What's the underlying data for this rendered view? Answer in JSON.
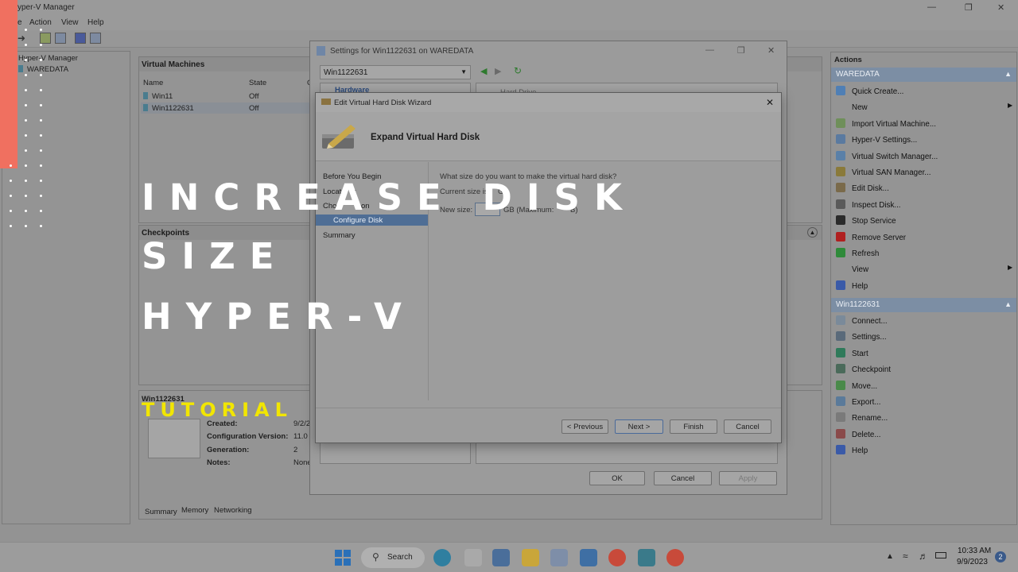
{
  "app": {
    "title": "Hyper-V Manager",
    "title_visible": "yper-V Manager",
    "menu": [
      "e",
      "Action",
      "View",
      "Help"
    ]
  },
  "tree": {
    "root": "Hyper-V Manager",
    "server": "WAREDATA"
  },
  "vms": {
    "header": "Virtual Machines",
    "columns": [
      "Name",
      "State",
      "C"
    ],
    "rows": [
      {
        "name": "Win11",
        "state": "Off"
      },
      {
        "name": "Win1122631",
        "state": "Off"
      }
    ]
  },
  "checkpoints": {
    "header": "Checkpoints"
  },
  "details": {
    "name": "Win1122631",
    "created_label": "Created:",
    "created_value": "9/2/2",
    "config_label": "Configuration Version:",
    "config_value": "11.0",
    "gen_label": "Generation:",
    "gen_value": "2",
    "notes_label": "Notes:",
    "notes_value": "None",
    "tabs": [
      "Summary",
      "Memory",
      "Networking"
    ]
  },
  "settings": {
    "title": "Settings for Win1122631 on WAREDATA",
    "vm_select": "Win1122631",
    "hardware": "Hardware",
    "right_partial": "Hard Drive",
    "ok": "OK",
    "cancel": "Cancel",
    "apply": "Apply"
  },
  "wizard": {
    "title": "Edit Virtual Hard Disk Wizard",
    "heading": "Expand Virtual Hard Disk",
    "steps": [
      "Before You Begin",
      "Locate Disk",
      "Choose Action",
      "Configure Disk",
      "Summary"
    ],
    "steps_visible": [
      "Before You Begin",
      "Locat",
      "Cho",
      "Configure Disk",
      "Summary"
    ],
    "steps_tail": [
      "k",
      "on"
    ],
    "active_step": 3,
    "question": "What size do you want to make the virtual hard disk?",
    "current_size": "Current size is",
    "current_size_tail": "G",
    "new_size_label": "New size:",
    "new_size_unit": "GB (Maximum:",
    "new_size_max_tail": "B)",
    "prev": "< Previous",
    "next": "Next >",
    "finish": "Finish",
    "cancel": "Cancel"
  },
  "actions": {
    "header": "Actions",
    "server_section": "WAREDATA",
    "server_items": [
      {
        "label": "Quick Create...",
        "icon": "quick-create-icon",
        "color": "#4f7fb5"
      },
      {
        "label": "New",
        "icon": "",
        "color": "",
        "submenu": true
      },
      {
        "label": "Import Virtual Machine...",
        "icon": "import-icon",
        "color": "#6f8f5a"
      },
      {
        "label": "Hyper-V Settings...",
        "icon": "hyperv-settings-icon",
        "color": "#5a7aa0"
      },
      {
        "label": "Virtual Switch Manager...",
        "icon": "switch-manager-icon",
        "color": "#5a80a8"
      },
      {
        "label": "Virtual SAN Manager...",
        "icon": "san-manager-icon",
        "color": "#8a7a3a"
      },
      {
        "label": "Edit Disk...",
        "icon": "edit-disk-icon",
        "color": "#7a6a4a"
      },
      {
        "label": "Inspect Disk...",
        "icon": "inspect-disk-icon",
        "color": "#5a5a5a"
      },
      {
        "label": "Stop Service",
        "icon": "stop-service-icon",
        "color": "#2a2a2a"
      },
      {
        "label": "Remove Server",
        "icon": "remove-server-icon",
        "color": "#b02020"
      },
      {
        "label": "Refresh",
        "icon": "refresh-icon",
        "color": "#2f8a3a"
      },
      {
        "label": "View",
        "icon": "",
        "color": "",
        "submenu": true
      },
      {
        "label": "Help",
        "icon": "help-icon",
        "color": "#3a5aa8"
      }
    ],
    "vm_section": "Win1122631",
    "vm_items": [
      {
        "label": "Connect...",
        "icon": "connect-icon",
        "color": "#7a8a9a"
      },
      {
        "label": "Settings...",
        "icon": "settings-icon",
        "color": "#5a6a7a"
      },
      {
        "label": "Start",
        "icon": "start-icon",
        "color": "#2f7a5a"
      },
      {
        "label": "Checkpoint",
        "icon": "checkpoint-icon",
        "color": "#4a6a5a"
      },
      {
        "label": "Move...",
        "icon": "move-icon",
        "color": "#4a8a4a"
      },
      {
        "label": "Export...",
        "icon": "export-icon",
        "color": "#5a7a9a"
      },
      {
        "label": "Rename...",
        "icon": "rename-icon",
        "color": "#7a7a7a"
      },
      {
        "label": "Delete...",
        "icon": "delete-icon",
        "color": "#8a4a4a"
      },
      {
        "label": "Help",
        "icon": "help-icon",
        "color": "#3a5aa8"
      }
    ]
  },
  "taskbar": {
    "search": "Search",
    "time": "10:33 AM",
    "date": "9/9/2023",
    "badge": "2"
  },
  "overlay": {
    "line1": "INCREASE DISK",
    "line2": "SIZE",
    "line3": "HYPER-V",
    "tag": "TUTORIAL",
    "accent": "#f07060",
    "tag_color": "#f2e600"
  }
}
